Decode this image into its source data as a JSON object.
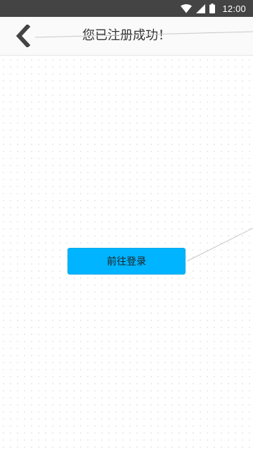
{
  "status_bar": {
    "icons": [
      "wifi-icon",
      "cellular-signal-icon",
      "battery-icon"
    ],
    "time": "12:00"
  },
  "header": {
    "back_icon": "chevron-left-icon",
    "title": "您已注册成功！"
  },
  "main": {
    "login_button_label": "前往登录"
  },
  "colors": {
    "status_bar_bg": "#444444",
    "header_bg": "#fafafa",
    "accent": "#00b4ff",
    "back_icon": "#444444"
  }
}
